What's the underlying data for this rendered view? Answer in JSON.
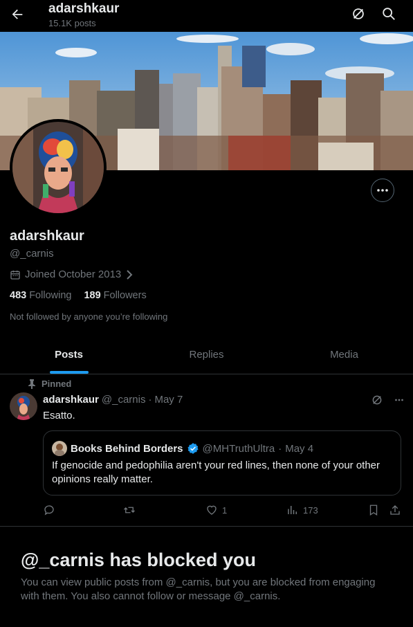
{
  "header": {
    "title": "adarshkaur",
    "post_count": "15.1K posts",
    "back_icon": "arrow-left-icon",
    "grok_icon": "grok-icon",
    "search_icon": "search-icon"
  },
  "profile": {
    "display_name": "adarshkaur",
    "handle": "@_carnis",
    "joined": "Joined October 2013",
    "following_count": "483",
    "following_label": "Following",
    "followers_count": "189",
    "followers_label": "Followers",
    "not_followed_text": "Not followed by anyone you’re following"
  },
  "tabs": [
    {
      "label": "Posts",
      "active": true
    },
    {
      "label": "Replies",
      "active": false
    },
    {
      "label": "Media",
      "active": false
    }
  ],
  "pinned_post": {
    "pinned_label": "Pinned",
    "author_name": "adarshkaur",
    "author_handle": "@_carnis",
    "separator": "·",
    "date": "May 7",
    "text": "Esatto.",
    "quote": {
      "author_name": "Books Behind Borders",
      "author_handle": "@MHTruthUltra",
      "date": "May 4",
      "text": "If genocide and pedophilia aren't your red lines, then none of your other opinions really matter."
    },
    "likes": "1",
    "views": "173"
  },
  "blocked": {
    "title": "@_carnis has blocked you",
    "body": "You can view public posts from @_carnis, but you are blocked from engaging with them. You also cannot follow or message @_carnis."
  },
  "colors": {
    "accent": "#1d9bf0",
    "muted": "#71767b",
    "border": "#2f3336",
    "text": "#e7e9ea"
  }
}
